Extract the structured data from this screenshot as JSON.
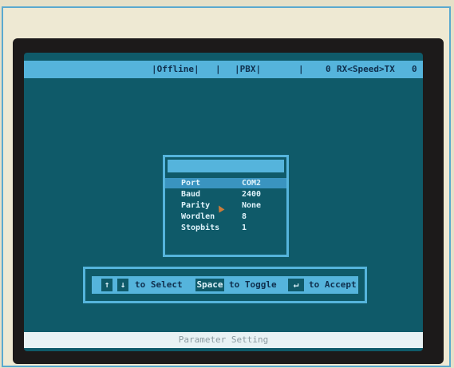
{
  "top_bar": {
    "mode": "|Offline|",
    "sep1": "|",
    "protocol": "|PBX|",
    "sep2": "|",
    "rx": "0",
    "speed": "RX<Speed>TX",
    "tx": "0"
  },
  "dialog": {
    "params": [
      {
        "label": "Port",
        "value": "COM2",
        "selected": true
      },
      {
        "label": "Baud",
        "value": "2400",
        "selected": false
      },
      {
        "label": "Parity",
        "value": "None",
        "selected": false
      },
      {
        "label": "Wordlen",
        "value": "8",
        "selected": false
      },
      {
        "label": "Stopbits",
        "value": "1",
        "selected": false
      }
    ]
  },
  "help_bar": {
    "up_key": "↑",
    "down_key": "↓",
    "select_text": "to Select",
    "space_key": "Space",
    "toggle_text": "to Toggle",
    "enter_key": "↵",
    "accept_text": "to Accept"
  },
  "bottom_bar": {
    "status": "Parameter Setting"
  },
  "colors": {
    "screen_bg": "#0f5a69",
    "accent": "#55b4dc",
    "text": "#dff3fb"
  }
}
